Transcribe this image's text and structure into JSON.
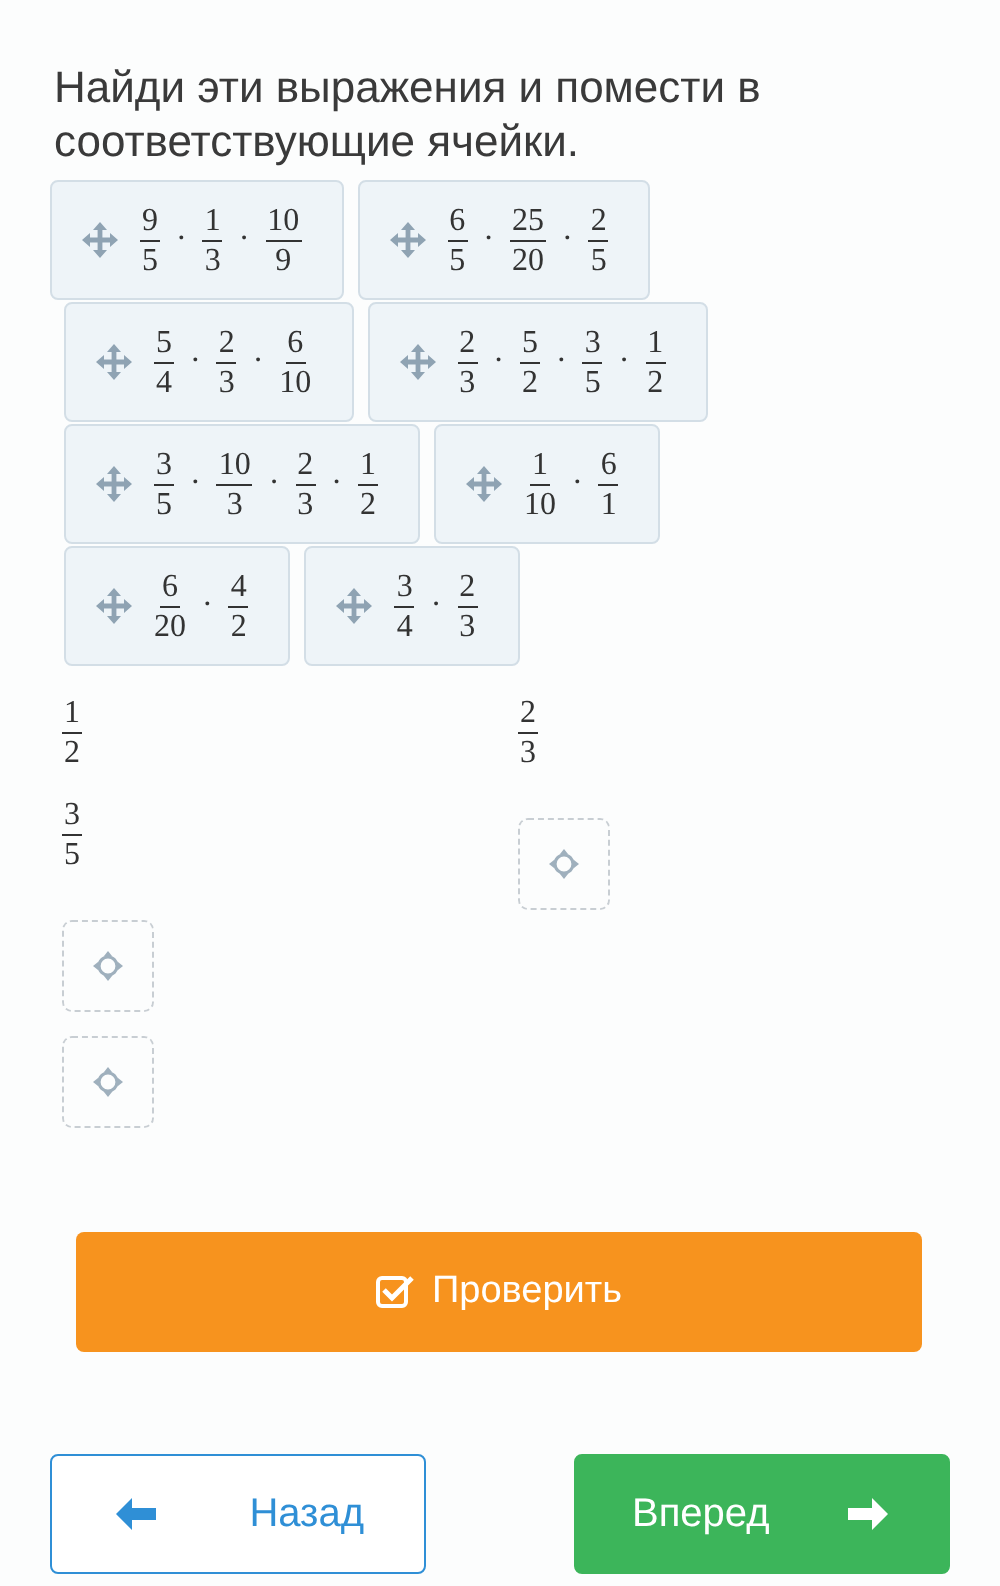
{
  "title": "Найди эти выражения и помести в соответствующие ячейки.",
  "card_rows": [
    {
      "cards": [
        {
          "operator": "·",
          "factors": [
            {
              "num": "9",
              "den": "5"
            },
            {
              "num": "1",
              "den": "3"
            },
            {
              "num": "10",
              "den": "9"
            }
          ]
        },
        {
          "operator": "·",
          "factors": [
            {
              "num": "6",
              "den": "5"
            },
            {
              "num": "25",
              "den": "20"
            },
            {
              "num": "2",
              "den": "5"
            }
          ]
        }
      ]
    },
    {
      "cards": [
        {
          "operator": "·",
          "factors": [
            {
              "num": "5",
              "den": "4"
            },
            {
              "num": "2",
              "den": "3"
            },
            {
              "num": "6",
              "den": "10"
            }
          ]
        },
        {
          "operator": "·",
          "factors": [
            {
              "num": "2",
              "den": "3"
            },
            {
              "num": "5",
              "den": "2"
            },
            {
              "num": "3",
              "den": "5"
            },
            {
              "num": "1",
              "den": "2"
            }
          ]
        }
      ]
    },
    {
      "cards": [
        {
          "operator": "·",
          "factors": [
            {
              "num": "3",
              "den": "5"
            },
            {
              "num": "10",
              "den": "3"
            },
            {
              "num": "2",
              "den": "3"
            },
            {
              "num": "1",
              "den": "2"
            }
          ]
        },
        {
          "operator": "·",
          "factors": [
            {
              "num": "1",
              "den": "10"
            },
            {
              "num": "6",
              "den": "1"
            }
          ]
        }
      ]
    },
    {
      "cards": [
        {
          "operator": "·",
          "factors": [
            {
              "num": "6",
              "den": "20"
            },
            {
              "num": "4",
              "den": "2"
            }
          ]
        },
        {
          "operator": "·",
          "factors": [
            {
              "num": "3",
              "den": "4"
            },
            {
              "num": "2",
              "den": "3"
            }
          ]
        }
      ]
    }
  ],
  "targets": [
    {
      "labels": [
        {
          "num": "1",
          "den": "2"
        },
        {
          "num": "3",
          "den": "5"
        }
      ],
      "slots": [
        {
          "kind": "drop-slot"
        },
        {
          "kind": "drop-slot"
        }
      ]
    },
    {
      "labels": [
        {
          "num": "2",
          "den": "3"
        }
      ],
      "slots": [
        {
          "kind": "drop-slot"
        }
      ]
    }
  ],
  "check_button": {
    "label": "Проверить"
  },
  "nav": [
    {
      "kind": "back",
      "label": "Назад"
    },
    {
      "kind": "forward",
      "label": "Вперед"
    }
  ]
}
